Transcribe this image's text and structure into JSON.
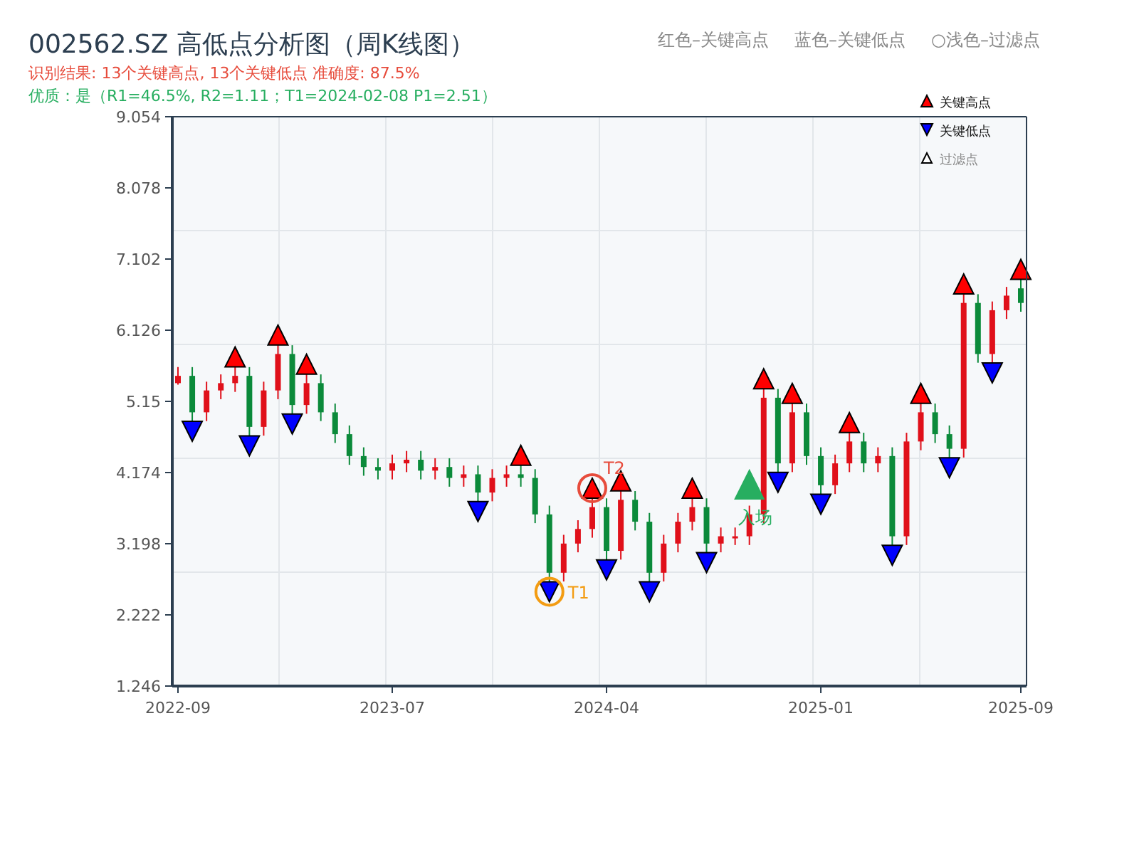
{
  "title": "002562.SZ 高低点分析图（周K线图）",
  "summary": "识别结果: 13个关键高点, 13个关键低点   准确度: 87.5%",
  "quality": "优质：是（R1=46.5%, R2=1.11；T1=2024-02-08 P1=2.51）",
  "color_legend": [
    {
      "text": "红色–关键高点"
    },
    {
      "text": "蓝色–关键低点"
    },
    {
      "text": "浅色–过滤点",
      "symbol": "○"
    }
  ],
  "chart_data": {
    "type": "candlestick",
    "categories": [
      "2022-09",
      null,
      null,
      null,
      null,
      null,
      null,
      null,
      null,
      null,
      null,
      null,
      null,
      null,
      null,
      "2023-07",
      null,
      null,
      null,
      null,
      null,
      null,
      null,
      null,
      null,
      null,
      null,
      null,
      null,
      null,
      "2024-04",
      null,
      null,
      null,
      null,
      null,
      null,
      null,
      null,
      null,
      null,
      null,
      null,
      null,
      null,
      "2025-01",
      null,
      null,
      null,
      null,
      null,
      null,
      null,
      null,
      null,
      null,
      null,
      null,
      null,
      "2025-09"
    ],
    "grid": true,
    "legend": "upper right",
    "ohlc": [
      [
        5.4,
        5.62,
        5.38,
        5.5
      ],
      [
        5.5,
        5.62,
        4.88,
        5.0
      ],
      [
        5.0,
        5.42,
        4.88,
        5.3
      ],
      [
        5.3,
        5.52,
        5.18,
        5.4
      ],
      [
        5.4,
        5.62,
        5.28,
        5.5
      ],
      [
        5.5,
        5.62,
        4.68,
        4.8
      ],
      [
        4.8,
        5.42,
        4.68,
        5.3
      ],
      [
        5.3,
        5.92,
        5.18,
        5.8
      ],
      [
        5.8,
        5.92,
        4.98,
        5.1
      ],
      [
        5.1,
        5.52,
        4.98,
        5.4
      ],
      [
        5.4,
        5.52,
        4.88,
        5.0
      ],
      [
        5.0,
        5.12,
        4.58,
        4.7
      ],
      [
        4.7,
        4.82,
        4.28,
        4.4
      ],
      [
        4.4,
        4.52,
        4.13,
        4.25
      ],
      [
        4.25,
        4.37,
        4.08,
        4.2
      ],
      [
        4.2,
        4.42,
        4.08,
        4.3
      ],
      [
        4.3,
        4.47,
        4.18,
        4.35
      ],
      [
        4.35,
        4.47,
        4.08,
        4.2
      ],
      [
        4.2,
        4.37,
        4.08,
        4.25
      ],
      [
        4.25,
        4.37,
        3.98,
        4.1
      ],
      [
        4.1,
        4.27,
        3.98,
        4.15
      ],
      [
        4.15,
        4.27,
        3.78,
        3.9
      ],
      [
        3.9,
        4.22,
        3.78,
        4.1
      ],
      [
        4.1,
        4.27,
        3.98,
        4.15
      ],
      [
        4.15,
        4.27,
        3.98,
        4.1
      ],
      [
        4.1,
        4.22,
        3.48,
        3.6
      ],
      [
        3.6,
        3.72,
        2.68,
        2.8
      ],
      [
        2.8,
        3.32,
        2.68,
        3.2
      ],
      [
        3.2,
        3.52,
        3.08,
        3.4
      ],
      [
        3.4,
        3.82,
        3.28,
        3.7
      ],
      [
        3.7,
        3.82,
        2.98,
        3.1
      ],
      [
        3.1,
        3.92,
        2.98,
        3.8
      ],
      [
        3.8,
        3.92,
        3.38,
        3.5
      ],
      [
        3.5,
        3.62,
        2.68,
        2.8
      ],
      [
        2.8,
        3.32,
        2.68,
        3.2
      ],
      [
        3.2,
        3.62,
        3.08,
        3.5
      ],
      [
        3.5,
        3.82,
        3.38,
        3.7
      ],
      [
        3.7,
        3.82,
        3.08,
        3.2
      ],
      [
        3.2,
        3.42,
        3.08,
        3.3
      ],
      [
        3.3,
        3.42,
        3.18,
        3.3
      ],
      [
        3.3,
        3.72,
        3.18,
        3.6
      ],
      [
        3.6,
        5.32,
        3.48,
        5.2
      ],
      [
        5.2,
        5.32,
        4.18,
        4.3
      ],
      [
        4.3,
        5.12,
        4.18,
        5.0
      ],
      [
        5.0,
        5.12,
        4.28,
        4.4
      ],
      [
        4.4,
        4.52,
        3.88,
        4.0
      ],
      [
        4.0,
        4.42,
        3.88,
        4.3
      ],
      [
        4.3,
        4.72,
        4.18,
        4.6
      ],
      [
        4.6,
        4.72,
        4.18,
        4.3
      ],
      [
        4.3,
        4.52,
        4.18,
        4.4
      ],
      [
        4.4,
        4.52,
        3.18,
        3.3
      ],
      [
        3.3,
        4.72,
        3.18,
        4.6
      ],
      [
        4.6,
        5.12,
        4.48,
        5.0
      ],
      [
        5.0,
        5.12,
        4.58,
        4.7
      ],
      [
        4.7,
        4.82,
        4.38,
        4.5
      ],
      [
        4.5,
        6.62,
        4.38,
        6.5
      ],
      [
        6.5,
        6.62,
        5.68,
        5.8
      ],
      [
        5.8,
        6.52,
        5.68,
        6.4
      ],
      [
        6.4,
        6.72,
        6.28,
        6.6
      ],
      [
        6.7,
        6.82,
        6.38,
        6.5
      ]
    ],
    "series": [
      {
        "name": "关键高点",
        "type": "scatter",
        "color": "#ff0000",
        "values": [
          null,
          null,
          null,
          null,
          5.76,
          null,
          null,
          6.06,
          null,
          5.66,
          null,
          null,
          null,
          null,
          null,
          null,
          null,
          null,
          null,
          null,
          null,
          null,
          null,
          null,
          4.41,
          null,
          null,
          null,
          null,
          3.96,
          null,
          4.06,
          null,
          null,
          null,
          null,
          3.96,
          null,
          null,
          null,
          null,
          5.46,
          null,
          5.26,
          null,
          null,
          null,
          4.86,
          null,
          null,
          null,
          null,
          5.26,
          null,
          null,
          6.76,
          null,
          null,
          null,
          6.96
        ]
      },
      {
        "name": "关键低点",
        "type": "scatter",
        "color": "#0000ff",
        "values": [
          null,
          4.74,
          null,
          null,
          null,
          4.54,
          null,
          null,
          4.84,
          null,
          null,
          null,
          null,
          null,
          null,
          null,
          null,
          null,
          null,
          null,
          null,
          3.64,
          null,
          null,
          null,
          null,
          2.54,
          null,
          null,
          null,
          2.84,
          null,
          null,
          2.54,
          null,
          null,
          null,
          2.94,
          null,
          null,
          null,
          null,
          4.04,
          null,
          null,
          3.74,
          null,
          null,
          null,
          null,
          3.04,
          null,
          null,
          null,
          4.24,
          null,
          null,
          5.54,
          null,
          null
        ]
      }
    ],
    "ylim": [
      1.246,
      9.054
    ],
    "yticks": [
      1.246,
      2.222,
      3.198,
      4.174,
      5.15,
      6.126,
      7.102,
      8.078,
      9.054
    ]
  },
  "signals": [
    {
      "kind": "target",
      "text": "T1",
      "color": "#f39c12"
    },
    {
      "kind": "target",
      "text": "T2",
      "color": "#e74c3c"
    },
    {
      "kind": "entry",
      "text": "入场",
      "color": "#27ae60"
    }
  ],
  "filtered_legend": "过滤点"
}
